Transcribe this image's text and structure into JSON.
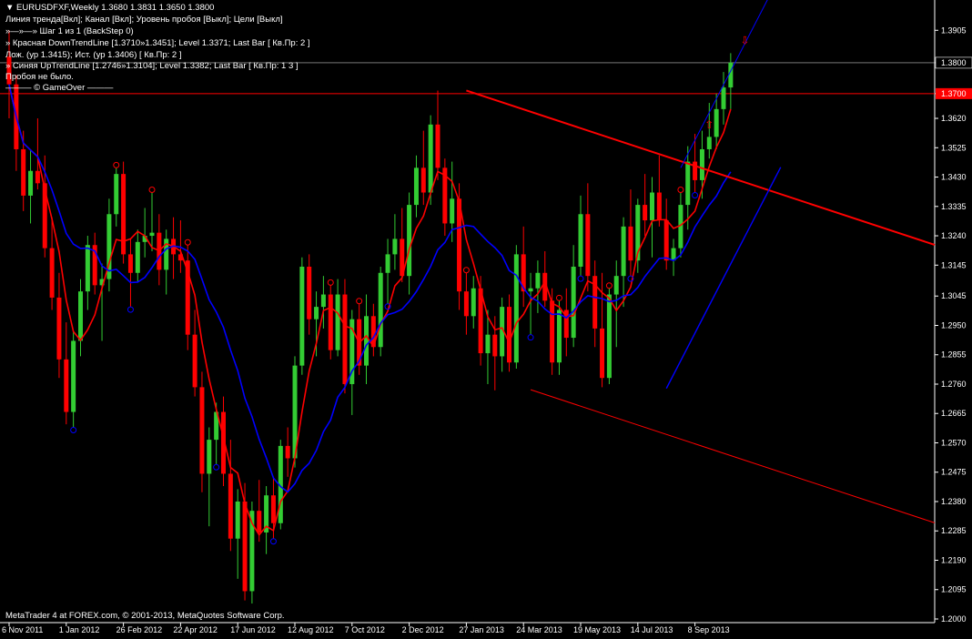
{
  "header": {
    "symbol_line": "▼ EURUSDFXF,Weekly  1.3680 1.3831 1.3650 1.3800",
    "lines": [
      "Линия тренда[Вкл]; Канал [Вкл]; Уровень пробоя [Выкл]; Цели [Выкл]",
      "»—»—» Шаг 1 из 1 (BackStep 0)",
      "» Красная DownTrendLine [1.3710»1.3451]; Level 1.3371; Last Bar [ Кв.Пр: 2 ]",
      "Лож. (ур 1.3415); Ист. (ур 1.3406) [ Кв.Пр: 2 ]",
      "» Синяя UpTrendLine [1.2746»1.3104]; Level 1.3382; Last Bar [ Кв.Пр: 1 3 ]",
      "Пробоя не было.",
      "——— © GameOver ———"
    ]
  },
  "footer": "MetaTrader 4 at FOREX.com, © 2001-2013, MetaQuotes Software Corp.",
  "price_badges": {
    "current": "1.3800",
    "red_level": "1.3700"
  },
  "colors": {
    "background": "#000000",
    "bull": "#33cc33",
    "bear": "#ff0000",
    "ma_fast": "#ff0000",
    "ma_slow": "#0000ff",
    "down_trendline": "#ff0000",
    "up_channel": "#0000ff",
    "axis": "#ffffff"
  },
  "chart_data": {
    "type": "candlestick",
    "symbol": "EURUSDFXF",
    "timeframe": "Weekly",
    "ylim": [
      1.2,
      1.395
    ],
    "y_ticks": [
      "1.3905",
      "1.3800",
      "1.3700",
      "1.3620",
      "1.3525",
      "1.3430",
      "1.3335",
      "1.3240",
      "1.3145",
      "1.3045",
      "1.2950",
      "1.2855",
      "1.2760",
      "1.2665",
      "1.2570",
      "1.2475",
      "1.2380",
      "1.2285",
      "1.2190",
      "1.2095",
      "1.2000"
    ],
    "x_ticks": [
      {
        "label": "6 Nov 2011",
        "bar": 0
      },
      {
        "label": "1 Jan 2012",
        "bar": 8
      },
      {
        "label": "26 Feb 2012",
        "bar": 16
      },
      {
        "label": "22 Apr 2012",
        "bar": 24
      },
      {
        "label": "17 Jun 2012",
        "bar": 32
      },
      {
        "label": "12 Aug 2012",
        "bar": 40
      },
      {
        "label": "7 Oct 2012",
        "bar": 48
      },
      {
        "label": "2 Dec 2012",
        "bar": 56
      },
      {
        "label": "27 Jan 2013",
        "bar": 64
      },
      {
        "label": "24 Mar 2013",
        "bar": 72
      },
      {
        "label": "19 May 2013",
        "bar": 80
      },
      {
        "label": "14 Jul 2013",
        "bar": 88
      },
      {
        "label": "8 Sep 2013",
        "bar": 96
      }
    ],
    "candles": [
      [
        1.382,
        1.3905,
        1.362,
        1.373
      ],
      [
        1.373,
        1.376,
        1.345,
        1.352
      ],
      [
        1.352,
        1.358,
        1.332,
        1.337
      ],
      [
        1.337,
        1.352,
        1.328,
        1.345
      ],
      [
        1.345,
        1.362,
        1.339,
        1.341
      ],
      [
        1.341,
        1.35,
        1.317,
        1.32
      ],
      [
        1.32,
        1.33,
        1.3,
        1.304
      ],
      [
        1.304,
        1.312,
        1.278,
        1.284
      ],
      [
        1.284,
        1.296,
        1.263,
        1.267
      ],
      [
        1.267,
        1.293,
        1.262,
        1.29
      ],
      [
        1.29,
        1.31,
        1.285,
        1.306
      ],
      [
        1.306,
        1.324,
        1.3,
        1.321
      ],
      [
        1.321,
        1.325,
        1.305,
        1.308
      ],
      [
        1.308,
        1.315,
        1.29,
        1.31
      ],
      [
        1.31,
        1.336,
        1.306,
        1.331
      ],
      [
        1.331,
        1.346,
        1.327,
        1.344
      ],
      [
        1.344,
        1.348,
        1.315,
        1.318
      ],
      [
        1.318,
        1.323,
        1.301,
        1.312
      ],
      [
        1.312,
        1.326,
        1.309,
        1.322
      ],
      [
        1.322,
        1.333,
        1.317,
        1.324
      ],
      [
        1.324,
        1.338,
        1.319,
        1.325
      ],
      [
        1.325,
        1.331,
        1.308,
        1.313
      ],
      [
        1.313,
        1.326,
        1.305,
        1.323
      ],
      [
        1.323,
        1.33,
        1.31,
        1.318
      ],
      [
        1.318,
        1.329,
        1.312,
        1.316
      ],
      [
        1.316,
        1.321,
        1.287,
        1.292
      ],
      [
        1.292,
        1.3,
        1.272,
        1.275
      ],
      [
        1.275,
        1.28,
        1.241,
        1.247
      ],
      [
        1.247,
        1.262,
        1.23,
        1.258
      ],
      [
        1.258,
        1.27,
        1.25,
        1.267
      ],
      [
        1.267,
        1.272,
        1.243,
        1.247
      ],
      [
        1.247,
        1.258,
        1.222,
        1.226
      ],
      [
        1.226,
        1.242,
        1.213,
        1.238
      ],
      [
        1.238,
        1.244,
        1.206,
        1.209
      ],
      [
        1.209,
        1.238,
        1.205,
        1.235
      ],
      [
        1.235,
        1.245,
        1.225,
        1.228
      ],
      [
        1.228,
        1.243,
        1.221,
        1.24
      ],
      [
        1.24,
        1.246,
        1.226,
        1.231
      ],
      [
        1.231,
        1.258,
        1.229,
        1.256
      ],
      [
        1.256,
        1.262,
        1.246,
        1.252
      ],
      [
        1.252,
        1.285,
        1.249,
        1.282
      ],
      [
        1.282,
        1.317,
        1.279,
        1.314
      ],
      [
        1.314,
        1.318,
        1.292,
        1.297
      ],
      [
        1.297,
        1.306,
        1.285,
        1.301
      ],
      [
        1.301,
        1.311,
        1.294,
        1.305
      ],
      [
        1.305,
        1.308,
        1.284,
        1.287
      ],
      [
        1.287,
        1.31,
        1.285,
        1.305
      ],
      [
        1.305,
        1.31,
        1.273,
        1.276
      ],
      [
        1.276,
        1.3,
        1.266,
        1.297
      ],
      [
        1.297,
        1.302,
        1.279,
        1.282
      ],
      [
        1.282,
        1.305,
        1.276,
        1.298
      ],
      [
        1.298,
        1.302,
        1.285,
        1.288
      ],
      [
        1.288,
        1.314,
        1.285,
        1.312
      ],
      [
        1.312,
        1.323,
        1.302,
        1.318
      ],
      [
        1.318,
        1.331,
        1.313,
        1.323
      ],
      [
        1.323,
        1.333,
        1.309,
        1.311
      ],
      [
        1.311,
        1.338,
        1.305,
        1.334
      ],
      [
        1.334,
        1.35,
        1.33,
        1.346
      ],
      [
        1.346,
        1.358,
        1.334,
        1.338
      ],
      [
        1.338,
        1.363,
        1.334,
        1.36
      ],
      [
        1.36,
        1.371,
        1.342,
        1.346
      ],
      [
        1.346,
        1.349,
        1.324,
        1.328
      ],
      [
        1.328,
        1.348,
        1.322,
        1.336
      ],
      [
        1.336,
        1.341,
        1.3,
        1.306
      ],
      [
        1.306,
        1.312,
        1.292,
        1.298
      ],
      [
        1.298,
        1.311,
        1.294,
        1.307
      ],
      [
        1.307,
        1.311,
        1.282,
        1.286
      ],
      [
        1.286,
        1.3,
        1.276,
        1.292
      ],
      [
        1.292,
        1.298,
        1.274,
        1.285
      ],
      [
        1.285,
        1.304,
        1.28,
        1.301
      ],
      [
        1.301,
        1.305,
        1.28,
        1.283
      ],
      [
        1.283,
        1.321,
        1.281,
        1.318
      ],
      [
        1.318,
        1.327,
        1.301,
        1.306
      ],
      [
        1.306,
        1.312,
        1.292,
        1.307
      ],
      [
        1.307,
        1.316,
        1.299,
        1.312
      ],
      [
        1.312,
        1.319,
        1.301,
        1.303
      ],
      [
        1.303,
        1.307,
        1.279,
        1.283
      ],
      [
        1.283,
        1.303,
        1.279,
        1.3
      ],
      [
        1.3,
        1.307,
        1.285,
        1.291
      ],
      [
        1.291,
        1.321,
        1.288,
        1.314
      ],
      [
        1.314,
        1.337,
        1.311,
        1.331
      ],
      [
        1.331,
        1.341,
        1.306,
        1.311
      ],
      [
        1.311,
        1.316,
        1.288,
        1.294
      ],
      [
        1.294,
        1.312,
        1.275,
        1.278
      ],
      [
        1.278,
        1.307,
        1.276,
        1.305
      ],
      [
        1.305,
        1.316,
        1.288,
        1.311
      ],
      [
        1.311,
        1.33,
        1.301,
        1.327
      ],
      [
        1.327,
        1.339,
        1.311,
        1.316
      ],
      [
        1.316,
        1.336,
        1.312,
        1.334
      ],
      [
        1.334,
        1.344,
        1.324,
        1.329
      ],
      [
        1.329,
        1.343,
        1.317,
        1.338
      ],
      [
        1.338,
        1.35,
        1.327,
        1.329
      ],
      [
        1.329,
        1.336,
        1.313,
        1.316
      ],
      [
        1.316,
        1.323,
        1.311,
        1.32
      ],
      [
        1.32,
        1.338,
        1.317,
        1.334
      ],
      [
        1.334,
        1.353,
        1.326,
        1.348
      ],
      [
        1.348,
        1.357,
        1.338,
        1.342
      ],
      [
        1.342,
        1.358,
        1.336,
        1.352
      ],
      [
        1.352,
        1.367,
        1.349,
        1.356
      ],
      [
        1.356,
        1.37,
        1.352,
        1.365
      ],
      [
        1.365,
        1.377,
        1.36,
        1.372
      ],
      [
        1.372,
        1.3831,
        1.365,
        1.38
      ]
    ],
    "down_trendline": {
      "from": [
        64,
        1.371
      ],
      "to": [
        98,
        1.3451
      ],
      "level": 1.3371
    },
    "up_trendline": {
      "from": [
        92,
        1.2746
      ],
      "to": [
        100,
        1.3104
      ],
      "level": 1.3382
    },
    "levels": [
      1.38,
      1.37
    ]
  }
}
